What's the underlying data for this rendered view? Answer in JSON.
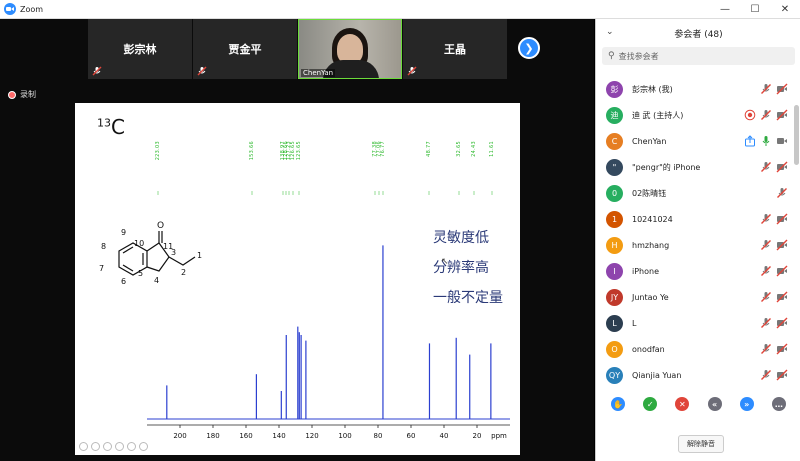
{
  "window": {
    "title": "Zoom",
    "minimize": "—",
    "maximize": "☐",
    "close": "✕"
  },
  "gallery": {
    "tiles": [
      {
        "name": "彭宗林",
        "muted": true
      },
      {
        "name": "贾金平",
        "muted": true
      },
      {
        "name": "ChenYan",
        "video": true
      },
      {
        "name": "王晶",
        "muted": true
      }
    ]
  },
  "recording": {
    "label": "录制"
  },
  "slide": {
    "nucleus_mass": "13",
    "nucleus_symbol": "C",
    "notes": [
      "灵敏度低",
      "分辨率高",
      "一般不定量"
    ],
    "peak_labels": [
      "223.03",
      "153.66",
      "138.97",
      "128.66",
      "127.23",
      "126.65",
      "123.65",
      "77.38",
      "77.06",
      "76.77",
      "48.77",
      "32.65",
      "24.43",
      "11.61"
    ],
    "atom_labels": {
      "o": "O",
      "n1": "1",
      "n2": "2",
      "n3": "3",
      "n4": "4",
      "n5": "5",
      "n6": "6",
      "n7": "7",
      "n8": "8",
      "n9": "9",
      "n10": "10",
      "n11": "11"
    },
    "axis_unit": "ppm"
  },
  "chart_data": {
    "type": "line",
    "title": "",
    "xlabel": "ppm",
    "ylabel": "",
    "xlim": [
      220,
      0
    ],
    "x_ticks": [
      200,
      180,
      160,
      140,
      120,
      100,
      80,
      60,
      40,
      20
    ],
    "series": [
      {
        "values": [
          {
            "x": 208.0,
            "y": 0.12
          },
          {
            "x": 153.7,
            "y": 0.16
          },
          {
            "x": 138.6,
            "y": 0.1
          },
          {
            "x": 135.6,
            "y": 0.3
          },
          {
            "x": 128.6,
            "y": 0.33
          },
          {
            "x": 127.7,
            "y": 0.31
          },
          {
            "x": 126.6,
            "y": 0.3
          },
          {
            "x": 123.7,
            "y": 0.28
          },
          {
            "x": 77.0,
            "y": 0.62
          },
          {
            "x": 48.8,
            "y": 0.27
          },
          {
            "x": 32.6,
            "y": 0.29
          },
          {
            "x": 24.4,
            "y": 0.23
          },
          {
            "x": 11.6,
            "y": 0.27
          }
        ]
      }
    ]
  },
  "participants": {
    "title": "参会者 (48)",
    "search_placeholder": "查找参会者",
    "list": [
      {
        "initial": "彭",
        "color": "#8e44ad",
        "name": "彭宗林 (我)",
        "mic": "muted",
        "video": "off"
      },
      {
        "initial": "迪",
        "color": "#27ae60",
        "name": "迪 武 (主持人)",
        "mic": "muted",
        "video": "off",
        "recording": true
      },
      {
        "initial": "C",
        "color": "#e67e22",
        "name": "ChenYan",
        "mic": "on",
        "video": "on",
        "share": true
      },
      {
        "initial": "\"",
        "color": "#34495e",
        "name": "\"pengr\"的 iPhone",
        "mic": "muted",
        "video": "off"
      },
      {
        "initial": "0",
        "color": "#27ae60",
        "name": "02陈晴钰",
        "mic": "muted",
        "video": "none"
      },
      {
        "initial": "1",
        "color": "#d35400",
        "name": "10241024",
        "mic": "muted",
        "video": "off"
      },
      {
        "initial": "H",
        "color": "#f39c12",
        "name": "hmzhang",
        "mic": "muted",
        "video": "off"
      },
      {
        "initial": "I",
        "color": "#8e44ad",
        "name": "iPhone",
        "mic": "muted",
        "video": "off"
      },
      {
        "initial": "JY",
        "color": "#c0392b",
        "name": "Juntao Ye",
        "mic": "muted",
        "video": "off"
      },
      {
        "initial": "L",
        "color": "#2c3e50",
        "name": "L",
        "mic": "muted",
        "video": "off"
      },
      {
        "initial": "O",
        "color": "#f39c12",
        "name": "onodfan",
        "mic": "muted",
        "video": "off"
      },
      {
        "initial": "QY",
        "color": "#2980b9",
        "name": "Qianjia Yuan",
        "mic": "muted",
        "video": "off"
      }
    ],
    "reactions": [
      {
        "name": "raise-hand",
        "glyph": "✋",
        "color": "#2d8cff"
      },
      {
        "name": "yes",
        "glyph": "✓",
        "color": "#2eaa40"
      },
      {
        "name": "no",
        "glyph": "✕",
        "color": "#e0453a"
      },
      {
        "name": "go-slower",
        "glyph": "«",
        "color": "#6d6d78"
      },
      {
        "name": "go-faster",
        "glyph": "»",
        "color": "#2d8cff"
      },
      {
        "name": "more",
        "glyph": "…",
        "color": "#6d6d78"
      }
    ],
    "unmute_label": "解除静音"
  }
}
